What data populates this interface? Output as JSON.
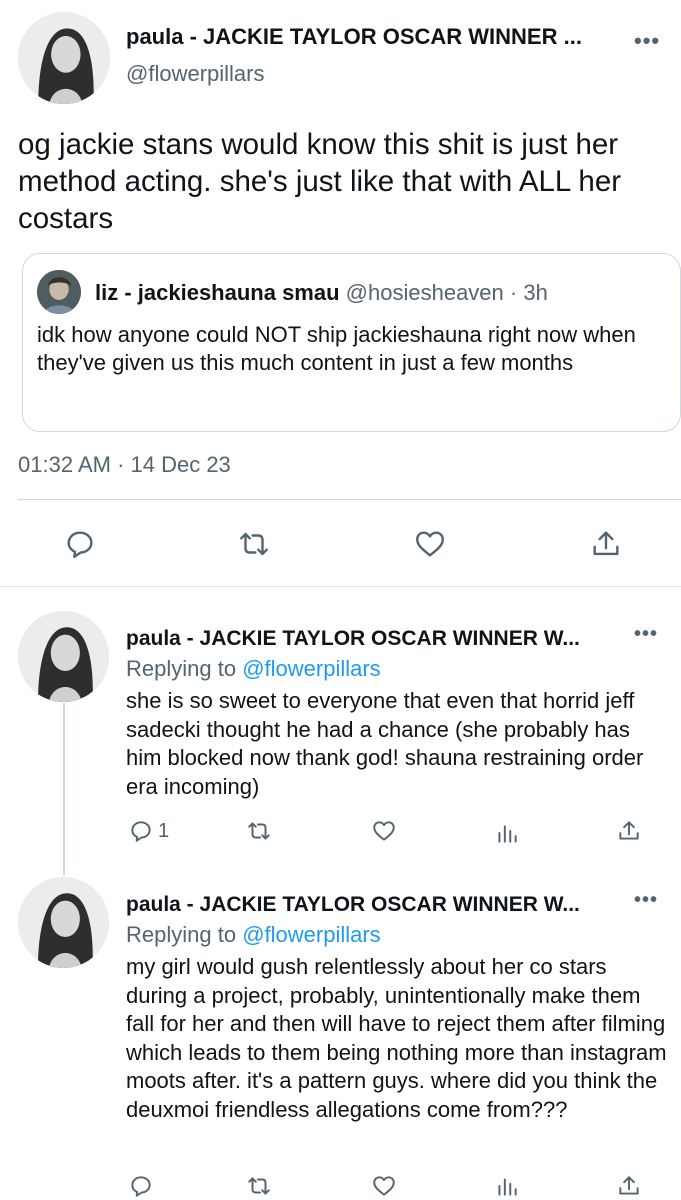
{
  "main_tweet": {
    "display_name": "paula - JACKIE TAYLOR OSCAR WINNER ...",
    "handle": "@flowerpillars",
    "more_icon": "more-horizontal-icon",
    "text": "og jackie stans would know this shit is just her method acting. she's just like that with ALL her costars",
    "quote": {
      "display_name": "liz - jackieshauna smau",
      "handle": "@hosiesheaven",
      "dot": "·",
      "time": "3h",
      "text": "idk how anyone could NOT ship jackieshauna right now when they've given us this much content in just a few months"
    },
    "timestamp": "01:32 AM · 14 Dec 23",
    "actions": [
      "reply-icon",
      "retweet-icon",
      "like-icon",
      "share-icon"
    ]
  },
  "replies": [
    {
      "display_name": "paula - JACKIE TAYLOR OSCAR WINNER W...",
      "replying_prefix": "Replying to",
      "replying_handle": "@flowerpillars",
      "text": "she is so sweet to everyone that even that horrid jeff sadecki thought he had a chance (she probably has him blocked now thank god! shauna restraining order era incoming)",
      "reply_count": "1"
    },
    {
      "display_name": "paula - JACKIE TAYLOR OSCAR WINNER W...",
      "replying_prefix": "Replying to",
      "replying_handle": "@flowerpillars",
      "text": "my girl would gush relentlessly about her co stars during a project, probably, unintentionally make them fall for her and then will have to reject them after filming which leads to them being nothing more than instagram moots after. it's a pattern guys. where did you think the deuxmoi friendless allegations come from???",
      "reply_count": ""
    }
  ],
  "colors": {
    "text": "#0f1419",
    "secondary": "#536471",
    "link": "#1d9bf0",
    "border": "#cfd9de"
  }
}
